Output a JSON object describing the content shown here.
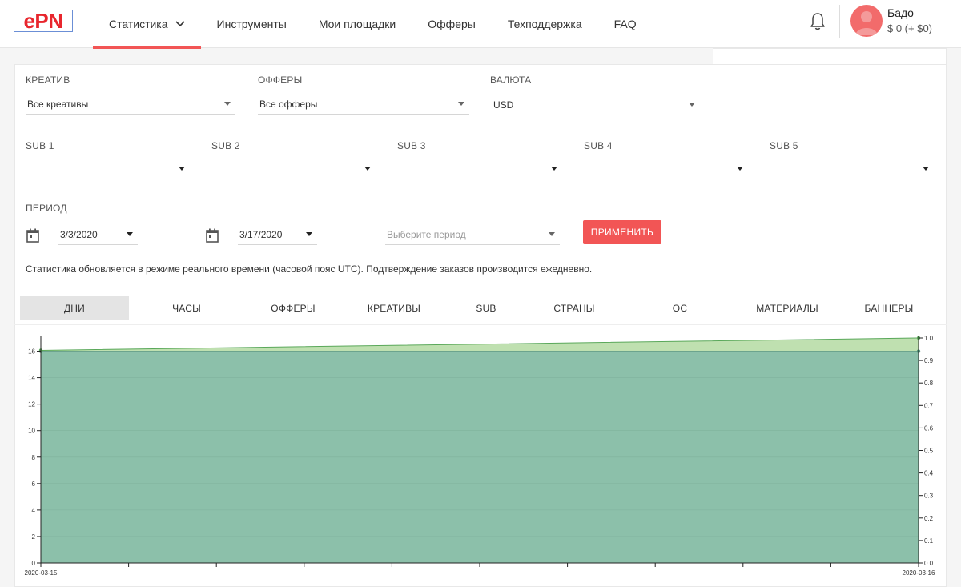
{
  "brand": {
    "logo_text": "ePN",
    "accent": "#f25555",
    "logo_color": "#e8262d"
  },
  "nav": {
    "items": [
      {
        "label": "Статистика",
        "active": true,
        "has_dropdown": true
      },
      {
        "label": "Инструменты"
      },
      {
        "label": "Мои площадки"
      },
      {
        "label": "Офферы"
      },
      {
        "label": "Техподдержка"
      },
      {
        "label": "FAQ"
      }
    ],
    "bell_icon": "bell-icon"
  },
  "user": {
    "name": "Бадо",
    "balance": "$ 0 (+ $0)",
    "avatar_icon": "user-avatar-icon"
  },
  "filters": {
    "creative": {
      "label": "КРЕАТИВ",
      "value": "Все креативы"
    },
    "offers": {
      "label": "ОФФЕРЫ",
      "value": "Все офферы"
    },
    "currency": {
      "label": "ВАЛЮТА",
      "value": "USD"
    },
    "subs": [
      {
        "label": "SUB 1",
        "value": ""
      },
      {
        "label": "SUB 2",
        "value": ""
      },
      {
        "label": "SUB 3",
        "value": ""
      },
      {
        "label": "SUB 4",
        "value": ""
      },
      {
        "label": "SUB 5",
        "value": ""
      }
    ],
    "period": {
      "label": "ПЕРИОД",
      "date_from": "3/3/2020",
      "date_to": "3/17/2020",
      "preset_placeholder": "Выберите период",
      "calendar_icon": "calendar-icon"
    },
    "apply_label": "ПРИМЕНИТЬ"
  },
  "note": "Статистика обновляется в режиме реального времени (часовой пояс UTC). Подтверждение заказов производится ежедневно.",
  "tabs": [
    {
      "label": "ДНИ",
      "active": true
    },
    {
      "label": "ЧАСЫ"
    },
    {
      "label": "ОФФЕРЫ"
    },
    {
      "label": "КРЕАТИВЫ"
    },
    {
      "label": "SUB"
    },
    {
      "label": "СТРАНЫ"
    },
    {
      "label": "ОС"
    },
    {
      "label": "МАТЕРИАЛЫ"
    },
    {
      "label": "БАННЕРЫ"
    }
  ],
  "chart_data": {
    "type": "area",
    "x": [
      "2020-03-15",
      "2020-03-16"
    ],
    "x_tick_labels": [
      "2020-03-15",
      "2020-03-16"
    ],
    "y_left_ticks": [
      0,
      2,
      4,
      6,
      8,
      10,
      12,
      14,
      16
    ],
    "y_right_ticks": [
      "0.0",
      "0.1",
      "0.2",
      "0.3",
      "0.4",
      "0.5",
      "0.6",
      "0.7",
      "0.8",
      "0.9",
      "1.0"
    ],
    "ylim_left": [
      0,
      17
    ],
    "ylim_right": [
      0,
      1.0
    ],
    "series": [
      {
        "axis": "left",
        "values": [
          16,
          16
        ],
        "color": "#8cc0aa"
      },
      {
        "axis": "right",
        "values": [
          0.945,
          1.0
        ],
        "color": "#bfe0b0"
      }
    ],
    "grid": true
  }
}
